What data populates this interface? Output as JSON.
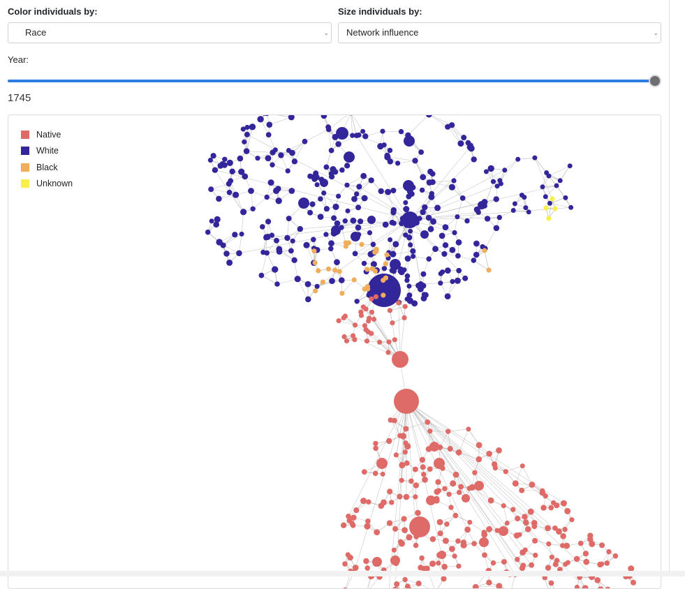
{
  "controls": {
    "color_label": "Color individuals by:",
    "color_value": "Race",
    "size_label": "Size individuals by:",
    "size_value": "Network influence",
    "year_label": "Year:",
    "year_value": "1745",
    "year_slider_fraction": 1.0
  },
  "legend": [
    {
      "label": "Native",
      "color": "#de6b67"
    },
    {
      "label": "White",
      "color": "#33259a"
    },
    {
      "label": "Black",
      "color": "#f0ae5d"
    },
    {
      "label": "Unknown",
      "color": "#f9ef4a"
    }
  ],
  "network": {
    "edge_color": "#b5b5b5",
    "node_color_by": "race",
    "node_size_by": "network influence"
  }
}
